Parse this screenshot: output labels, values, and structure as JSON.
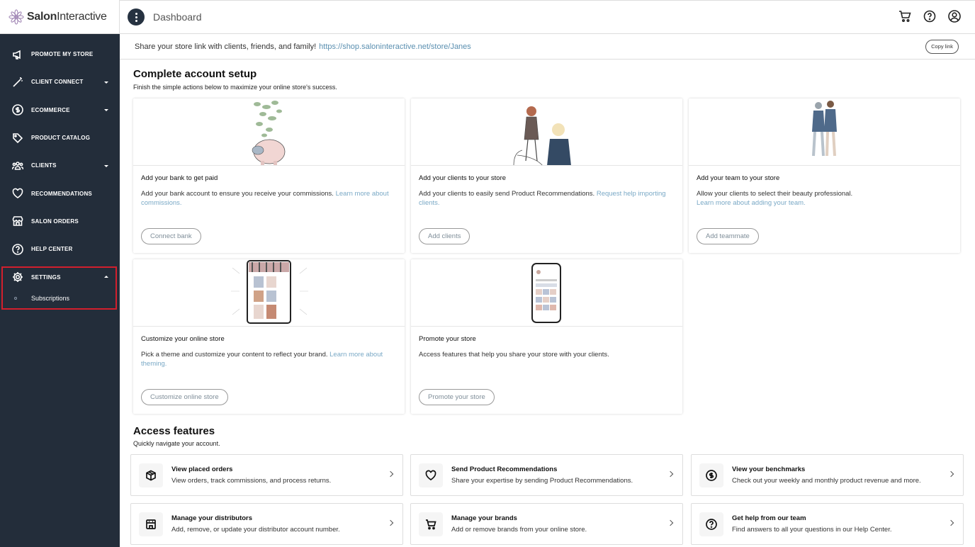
{
  "brand": {
    "name_bold": "Salon",
    "name_rest": "Interactive"
  },
  "sidebar": {
    "items": [
      {
        "label": "PROMOTE MY STORE",
        "icon": "megaphone-icon"
      },
      {
        "label": "CLIENT CONNECT",
        "icon": "wand-icon",
        "caret": "down"
      },
      {
        "label": "ECOMMERCE",
        "icon": "dollar-icon",
        "caret": "down"
      },
      {
        "label": "PRODUCT CATALOG",
        "icon": "tag-icon"
      },
      {
        "label": "CLIENTS",
        "icon": "people-icon",
        "caret": "down"
      },
      {
        "label": "RECOMMENDATIONS",
        "icon": "heart-icon"
      },
      {
        "label": "SALON ORDERS",
        "icon": "store-icon"
      },
      {
        "label": "HELP CENTER",
        "icon": "help-icon"
      },
      {
        "label": "SETTINGS",
        "icon": "gear-icon",
        "caret": "up"
      }
    ],
    "sub_item": "Subscriptions"
  },
  "header": {
    "title": "Dashboard"
  },
  "share": {
    "text": "Share your store link with clients, friends, and family!",
    "link": "https://shop.saloninteractive.net/store/Janes",
    "copy_label": "Copy link"
  },
  "setup": {
    "title": "Complete account setup",
    "subtitle": "Finish the simple actions below to maximize your online store's success.",
    "cards": [
      {
        "title": "Add your bank to get paid",
        "desc": "Add your bank account to ensure you receive your commissions. ",
        "link": "Learn more about commissions.",
        "button": "Connect bank"
      },
      {
        "title": "Add your clients to your store",
        "desc": "Add your clients to easily send Product Recommendations. ",
        "link": "Request help importing clients.",
        "button": "Add clients"
      },
      {
        "title": "Add your team to your store",
        "desc": "Allow your clients to select their beauty professional. ",
        "link": "Learn more about adding your team.",
        "button": "Add teammate"
      },
      {
        "title": "Customize your online store",
        "desc": "Pick a theme and customize your content to reflect your brand. ",
        "link": "Learn more about theming.",
        "button": "Customize online store"
      },
      {
        "title": "Promote your store",
        "desc": "Access features that help you share your store with your clients.",
        "link": "",
        "button": "Promote your store"
      }
    ]
  },
  "features": {
    "title": "Access features",
    "subtitle": "Quickly navigate your account.",
    "items": [
      {
        "title": "View placed orders",
        "desc": "View orders, track commissions, and process returns.",
        "icon": "box-icon"
      },
      {
        "title": "Send Product Recommendations",
        "desc": "Share your expertise by sending Product Recommendations.",
        "icon": "heart-icon"
      },
      {
        "title": "View your benchmarks",
        "desc": "Check out your weekly and monthly product revenue and more.",
        "icon": "dollar-icon"
      },
      {
        "title": "Manage your distributors",
        "desc": "Add, remove, or update your distributor account number.",
        "icon": "building-icon"
      },
      {
        "title": "Manage your brands",
        "desc": "Add or remove brands from your online store.",
        "icon": "cart-icon"
      },
      {
        "title": "Get help from our team",
        "desc": "Find answers to all your questions in our Help Center.",
        "icon": "help-icon"
      }
    ]
  }
}
